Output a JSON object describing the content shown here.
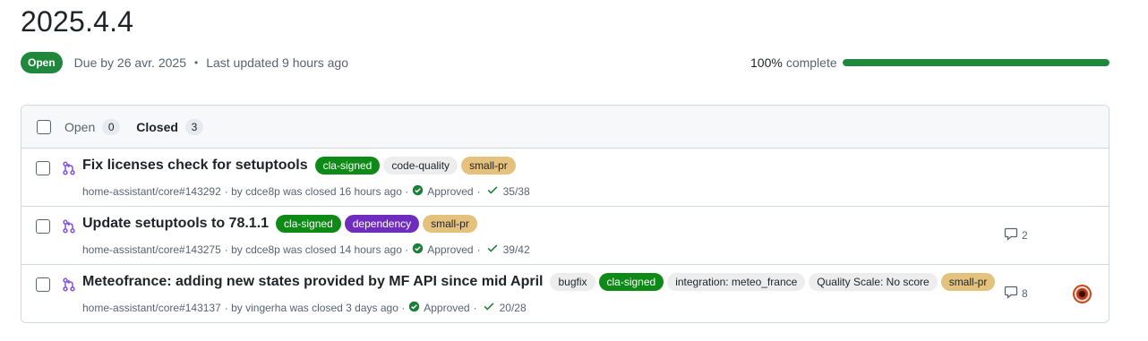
{
  "milestone": {
    "title": "2025.4.4",
    "state": "Open",
    "due": "Due by 26 avr. 2025",
    "separator": "•",
    "updated": "Last updated 9 hours ago",
    "progress_pct_text": "100%",
    "progress_suffix": "complete",
    "progress_fraction": 1.0
  },
  "filter_bar": {
    "open_label": "Open",
    "open_count": "0",
    "closed_label": "Closed",
    "closed_count": "3"
  },
  "colors": {
    "open_green": "#1f883d",
    "pr_purple": "#8250df",
    "check_green": "#1a7f37"
  },
  "pull_requests": [
    {
      "title": "Fix licenses check for setuptools",
      "labels": [
        {
          "text": "cla-signed",
          "bg": "#0e8a16",
          "fg": "#ffffff"
        },
        {
          "text": "code-quality",
          "bg": "#ededed",
          "fg": "#1f2328"
        },
        {
          "text": "small-pr",
          "bg": "#e4c17d",
          "fg": "#1f2328"
        }
      ],
      "ref": "home-assistant/core#143292",
      "closed_text": "· by cdce8p was closed 16 hours ago ·",
      "review": "Approved",
      "checks_sep": "·",
      "checks": "35/38",
      "comments": ""
    },
    {
      "title": "Update setuptools to 78.1.1",
      "labels": [
        {
          "text": "cla-signed",
          "bg": "#0e8a16",
          "fg": "#ffffff"
        },
        {
          "text": "dependency",
          "bg": "#6f2dbd",
          "fg": "#ffffff"
        },
        {
          "text": "small-pr",
          "bg": "#e4c17d",
          "fg": "#1f2328"
        }
      ],
      "ref": "home-assistant/core#143275",
      "closed_text": "· by cdce8p was closed 14 hours ago ·",
      "review": "Approved",
      "checks_sep": "·",
      "checks": "39/42",
      "comments": "2"
    },
    {
      "title": "Meteofrance: adding new states provided by MF API since mid April",
      "labels": [
        {
          "text": "bugfix",
          "bg": "#ededed",
          "fg": "#1f2328"
        },
        {
          "text": "cla-signed",
          "bg": "#0e8a16",
          "fg": "#ffffff"
        },
        {
          "text": "integration: meteo_france",
          "bg": "#ededed",
          "fg": "#1f2328"
        },
        {
          "text": "Quality Scale: No score",
          "bg": "#ededed",
          "fg": "#1f2328"
        },
        {
          "text": "small-pr",
          "bg": "#e4c17d",
          "fg": "#1f2328"
        }
      ],
      "ref": "home-assistant/core#143137",
      "closed_text": "· by vingerha was closed 3 days ago ·",
      "review": "Approved",
      "checks_sep": "·",
      "checks": "20/28",
      "comments": "8",
      "has_avatar": true
    }
  ]
}
